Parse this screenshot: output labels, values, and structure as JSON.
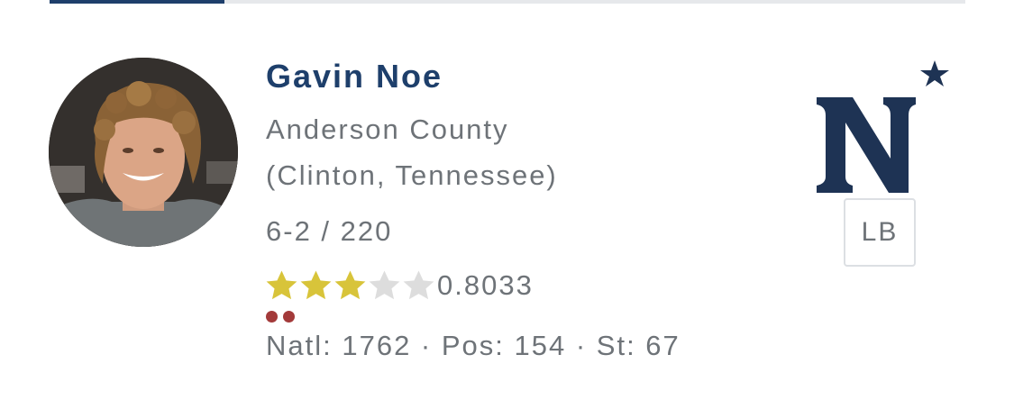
{
  "tabs": {
    "active_color": "#1e3f6b",
    "track_color": "#e6e8eb"
  },
  "player": {
    "name": "Gavin Noe",
    "school_line1": "Anderson County",
    "school_line2": "(Clinton, Tennessee)",
    "height_weight": "6-2 / 220",
    "star_rating": 3,
    "star_max": 5,
    "rating": "0.8033",
    "indicator_dots": 2,
    "rankings": "Natl: 1762 · Pos: 154 · St: 67",
    "position": "LB",
    "avatar_icon": "player-photo"
  },
  "team": {
    "logo_icon": "navy-n-star-logo",
    "logo_color": "#1e3354"
  },
  "colors": {
    "name": "#1e3f6b",
    "text_gray": "#6e7378",
    "star_filled": "#d8c43a",
    "star_empty": "#dddddd",
    "dot": "#a33a3a"
  }
}
